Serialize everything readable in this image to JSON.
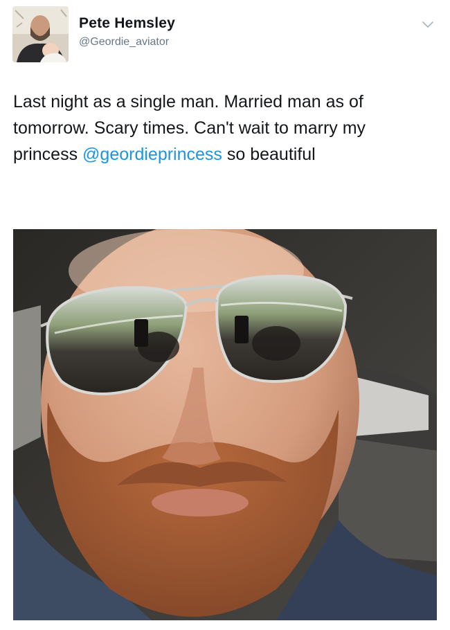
{
  "tweet": {
    "author": {
      "display_name": "Pete Hemsley",
      "handle": "@Geordie_aviator"
    },
    "text": {
      "part1": "Last night as a single man. Married man as of tomorrow. Scary times. Can't wait to marry my princess ",
      "mention": "@geordieprincess",
      "part2": " so beautiful"
    },
    "colors": {
      "mention": "#1b95e0",
      "text": "#14171a",
      "handle": "#657786"
    },
    "icons": {
      "menu": "chevron-down-icon"
    }
  }
}
